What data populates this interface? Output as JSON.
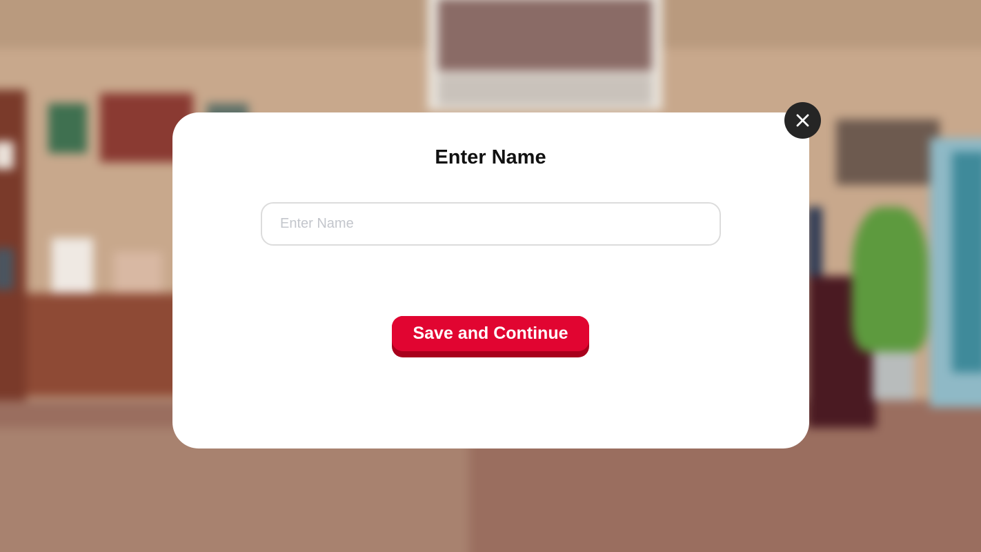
{
  "dialog": {
    "title": "Enter Name",
    "name_input": {
      "value": "",
      "placeholder": "Enter Name"
    },
    "save_button_label": "Save and Continue",
    "close_icon": "close-icon"
  },
  "colors": {
    "primary_button": "#e10531",
    "close_button": "#252525",
    "dialog_background": "#ffffff"
  }
}
